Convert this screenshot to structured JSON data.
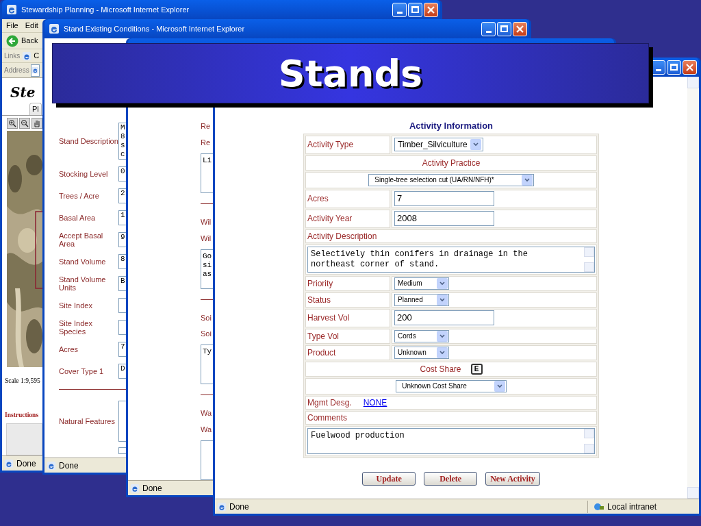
{
  "slide": {
    "title": "Stands"
  },
  "planning_window": {
    "title": "Stewardship Planning - Microsoft Internet Explorer",
    "menu": [
      "File",
      "Edit"
    ],
    "back": "Back",
    "links_label": "Links",
    "links_item": "C",
    "address_label": "Address",
    "logo": "Ste",
    "tab": "Pl",
    "scale": "Scale 1:9,595",
    "instructions": "Instructions",
    "status": "Done"
  },
  "conditions_window": {
    "title": "Stand Existing Conditions - Microsoft Internet Explorer",
    "fields": [
      {
        "label": "Stand Description",
        "value_lines": [
          "M",
          "8",
          "s",
          "c"
        ]
      },
      {
        "label": "Stocking Level",
        "value_lines": [
          "0"
        ]
      },
      {
        "label": "Trees / Acre",
        "value_lines": [
          "2"
        ]
      },
      {
        "label": "Basal Area",
        "value_lines": [
          "1"
        ]
      },
      {
        "label": "Accept Basal Area",
        "value_lines": [
          "9"
        ]
      },
      {
        "label": "Stand Volume",
        "value_lines": [
          "8"
        ]
      },
      {
        "label": "Stand Volume Units",
        "value_lines": [
          "B"
        ]
      },
      {
        "label": "Site Index"
      },
      {
        "label": "Site Index Species"
      },
      {
        "label": "Acres",
        "value_lines": [
          "7"
        ]
      },
      {
        "label": "Cover Type 1",
        "value_lines": [
          "D"
        ]
      }
    ],
    "notes_label": "Natural Features",
    "status": "Done"
  },
  "resources_window": {
    "sections": [
      {
        "labels": [
          "Re",
          "Re"
        ],
        "value_lines": [
          "Li"
        ]
      },
      {
        "labels": [
          "Wil",
          "Wil"
        ],
        "value_lines": [
          "Go",
          "si",
          "as"
        ]
      },
      {
        "labels": [
          "Soi",
          "Soi"
        ],
        "value_lines": [
          "Ty"
        ]
      },
      {
        "labels": [
          "Wa",
          "Wa"
        ]
      }
    ],
    "status": "Done"
  },
  "activity_window": {
    "heading": "Activity Information",
    "rows": [
      {
        "kind": "select",
        "label": "Activity Type",
        "value": "Timber_Silviculture"
      },
      {
        "kind": "heading",
        "label": "Activity Practice"
      },
      {
        "kind": "wide_select",
        "value": "Single-tree selection cut (UA/RN/NFH)*"
      },
      {
        "kind": "input",
        "label": "Acres",
        "value": "7"
      },
      {
        "kind": "input",
        "label": "Activity Year",
        "value": "2008"
      },
      {
        "kind": "caption",
        "label": "Activity Description"
      },
      {
        "kind": "textarea",
        "lines": [
          "Selectively thin conifers in drainage in the",
          "northeast corner of stand."
        ]
      },
      {
        "kind": "small_select",
        "label": "Priority",
        "value": "Medium"
      },
      {
        "kind": "small_select",
        "label": "Status",
        "value": "Planned"
      },
      {
        "kind": "input",
        "label": "Harvest Vol",
        "value": "200"
      },
      {
        "kind": "small_select",
        "label": "Type Vol",
        "value": "Cords"
      },
      {
        "kind": "small_select",
        "label": "Product",
        "value": "Unknown"
      },
      {
        "kind": "heading",
        "label": "Cost Share",
        "badge": "E"
      },
      {
        "kind": "wide_select",
        "value": "Unknown Cost Share"
      },
      {
        "kind": "link",
        "label": "Mgmt Desg.",
        "value": "NONE"
      },
      {
        "kind": "caption",
        "label": "Comments"
      },
      {
        "kind": "textarea",
        "lines": [
          "Fuelwood production"
        ]
      }
    ],
    "buttons": [
      "Update",
      "Delete",
      "New Activity"
    ],
    "status": "Done",
    "zone": "Local intranet"
  }
}
